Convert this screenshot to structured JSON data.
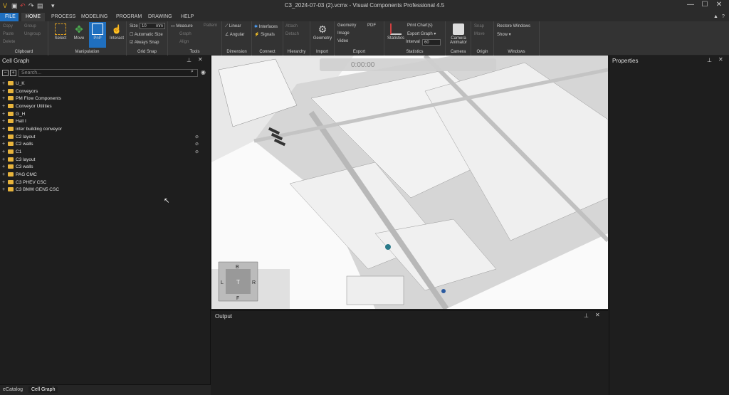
{
  "window": {
    "title": "C3_2024-07-03 (2).vcmx - Visual Components Professional 4.5",
    "minimize": "—",
    "maximize": "☐",
    "close": "✕"
  },
  "tabs": [
    {
      "label": "FILE"
    },
    {
      "label": "HOME"
    },
    {
      "label": "PROCESS"
    },
    {
      "label": "MODELING"
    },
    {
      "label": "PROGRAM"
    },
    {
      "label": "DRAWING"
    },
    {
      "label": "HELP"
    }
  ],
  "ribbon": {
    "clipboard": {
      "copy": "Copy",
      "paste": "Paste",
      "delete": "Delete",
      "group": "Group",
      "ungroup": "Ungroup",
      "label": "Clipboard"
    },
    "manipulation": {
      "select": "Select",
      "move": "Move",
      "pnp": "PnP",
      "interact": "Interact",
      "label": "Manipulation"
    },
    "grid_snap": {
      "size_label": "Size",
      "size_value": "10",
      "size_unit": "mm",
      "auto_size": "Automatic Size",
      "always_snap": "Always Snap",
      "label": "Grid Snap"
    },
    "tools": {
      "measure": "Measure",
      "pattern": "Pattern",
      "graph": "Graph",
      "align": "Align",
      "label": "Tools"
    },
    "dimension": {
      "linear": "Linear",
      "angular": "Angular",
      "label": "Dimension"
    },
    "connect": {
      "interfaces": "Interfaces",
      "signals": "Signals",
      "label": "Connect"
    },
    "hierarchy": {
      "attach": "Attach",
      "detach": "Detach",
      "label": "Hierarchy"
    },
    "import": {
      "geometry": "Geometry",
      "label": "Import"
    },
    "export": {
      "geometry": "Geometry",
      "pdf": "PDF",
      "image": "Image",
      "video": "Video",
      "label": "Export"
    },
    "statistics": {
      "statistics": "Statistics",
      "print_charts": "Print Chart(s)",
      "export_graph": "Export Graph ▾",
      "interval_label": "Interval",
      "interval_value": "60",
      "label": "Statistics"
    },
    "camera": {
      "camera_animator": "Camera Animator",
      "label": "Camera"
    },
    "origin": {
      "snap": "Snap",
      "move": "Move",
      "label": "Origin"
    },
    "windows": {
      "restore": "Restore Windows",
      "show": "Show ▾",
      "label": "Windows"
    }
  },
  "cell_graph": {
    "title": "Cell Graph",
    "search_placeholder": "Search...",
    "items": [
      {
        "label": "U_K"
      },
      {
        "label": "Conveyors"
      },
      {
        "label": "PM Flow Components"
      },
      {
        "label": "Conveyor Utilities"
      },
      {
        "label": "G_H"
      },
      {
        "label": "Hall I"
      },
      {
        "label": "inter building conveyor"
      },
      {
        "label": "C2 layout"
      },
      {
        "label": "C2 walls"
      },
      {
        "label": "C1"
      },
      {
        "label": "C3 layout"
      },
      {
        "label": "C3 walls"
      },
      {
        "label": "PAG CMC"
      },
      {
        "label": "C3 PHEV CSC"
      },
      {
        "label": "C3 BMW GEN5 CSC"
      }
    ]
  },
  "bottom_tabs": [
    {
      "label": "eCatalog"
    },
    {
      "label": "Cell Graph"
    }
  ],
  "viewport": {
    "sim_time": "0:00:00",
    "navcube": {
      "top": "B",
      "left": "L",
      "center": "T",
      "right": "R",
      "bottom": "F"
    }
  },
  "output": {
    "title": "Output"
  },
  "properties": {
    "title": "Properties"
  }
}
